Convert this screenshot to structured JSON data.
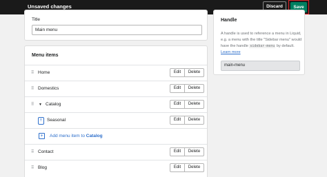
{
  "topbar": {
    "title": "Unsaved changes",
    "discard_label": "Discard",
    "save_label": "Save"
  },
  "title_card": {
    "label": "Title",
    "value": "Main menu"
  },
  "menu_card": {
    "heading": "Menu items",
    "items": [
      {
        "label": "Home",
        "edit": "Edit",
        "delete": "Delete"
      },
      {
        "label": "Domestics",
        "edit": "Edit",
        "delete": "Delete"
      },
      {
        "label": "Catalog",
        "edit": "Edit",
        "delete": "Delete"
      },
      {
        "label": "Seasonal",
        "edit": "Edit",
        "delete": "Delete"
      },
      {
        "label": "Contact",
        "edit": "Edit",
        "delete": "Delete"
      },
      {
        "label": "Blog",
        "edit": "Edit",
        "delete": "Delete"
      }
    ],
    "add_link_prefix": "Add menu item to ",
    "add_link_target": "Catalog"
  },
  "handle_card": {
    "heading": "Handle",
    "desc_1": "A handle is used to reference a menu in Liquid, e.g. a menu with the title \"Sidebar menu\" would have the handle",
    "desc_code": "sidebar-menu",
    "desc_2": " by default. ",
    "learn_more": "Learn more",
    "value": "main-menu"
  },
  "colors": {
    "topbar": "#1a1a1a",
    "save": "#008060",
    "save_highlight": "#e2272b",
    "link": "#2c6ecb"
  }
}
